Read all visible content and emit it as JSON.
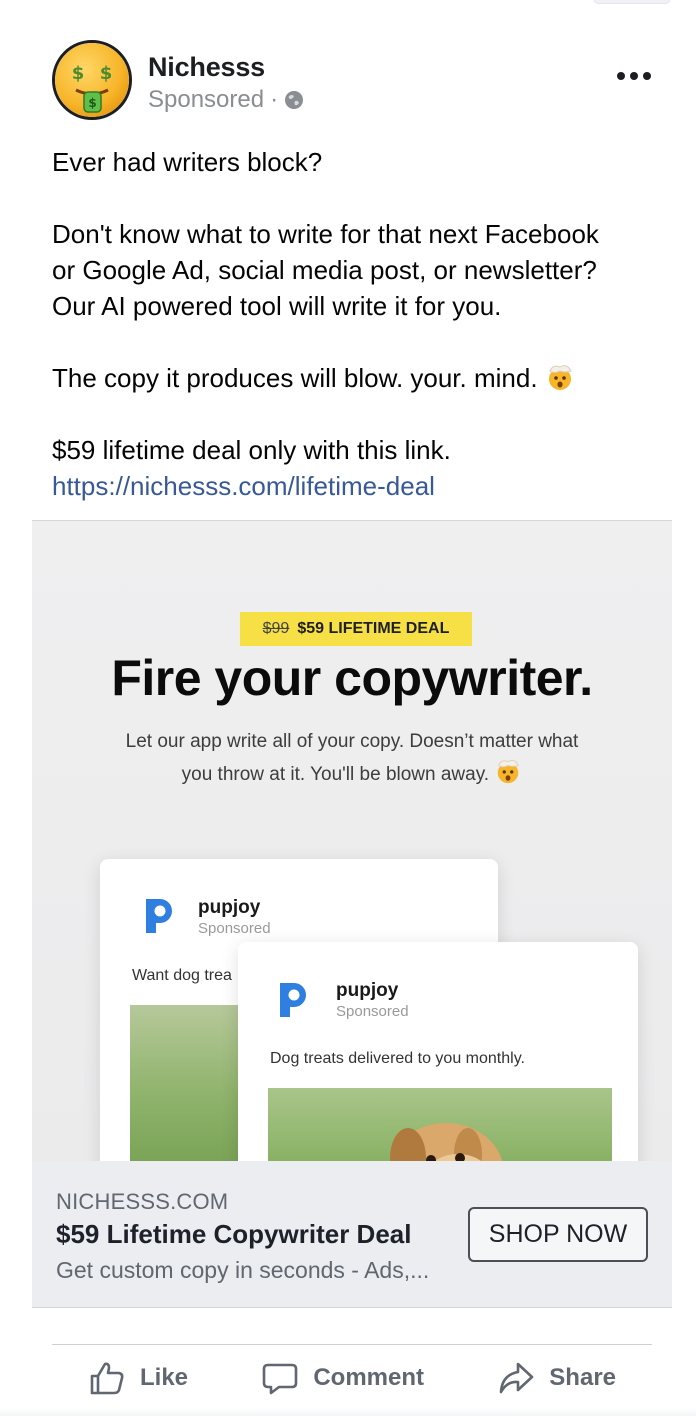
{
  "post": {
    "page_name": "Nichesss",
    "sponsored_label": "Sponsored",
    "separator": "·",
    "text": {
      "line1": "Ever had writers block?",
      "para2_line1": "Don't know what to write for that next Facebook",
      "para2_line2": "or Google Ad, social media post, or newsletter?",
      "para2_line3": "Our AI powered tool will write it for you.",
      "para3": "The copy it produces will blow. your. mind.",
      "para4": "$59 lifetime deal only with this link.",
      "link": "https://nichesss.com/lifetime-deal"
    },
    "icons": {
      "avatar": "money-mouth-face-emoji",
      "audience": "globe-icon",
      "more": "more-options-icon",
      "text_emoji": "exploding-head-emoji"
    }
  },
  "creative": {
    "badge_old_price": "$99",
    "badge_text": "$59 LIFETIME DEAL",
    "headline": "Fire your copywriter.",
    "subhead_line1": "Let our app write all of your copy. Doesn’t matter what",
    "subhead_line2": "you throw at it. You'll be blown away.",
    "back_card": {
      "name": "pupjoy",
      "sponsored": "Sponsored",
      "text": "Want dog trea"
    },
    "front_card": {
      "name": "pupjoy",
      "sponsored": "Sponsored",
      "text": "Dog treats delivered to you monthly."
    }
  },
  "link_preview": {
    "domain": "NICHESSS.COM",
    "title": "$59 Lifetime Copywriter Deal",
    "description": "Get custom copy in seconds - Ads,...",
    "cta": "SHOP NOW"
  },
  "actions": {
    "like": "Like",
    "comment": "Comment",
    "share": "Share"
  },
  "colors": {
    "link": "#385898",
    "secondary_text": "#606770",
    "badge_yellow": "#f7e046",
    "pupjoy_blue": "#2f7fe0"
  }
}
